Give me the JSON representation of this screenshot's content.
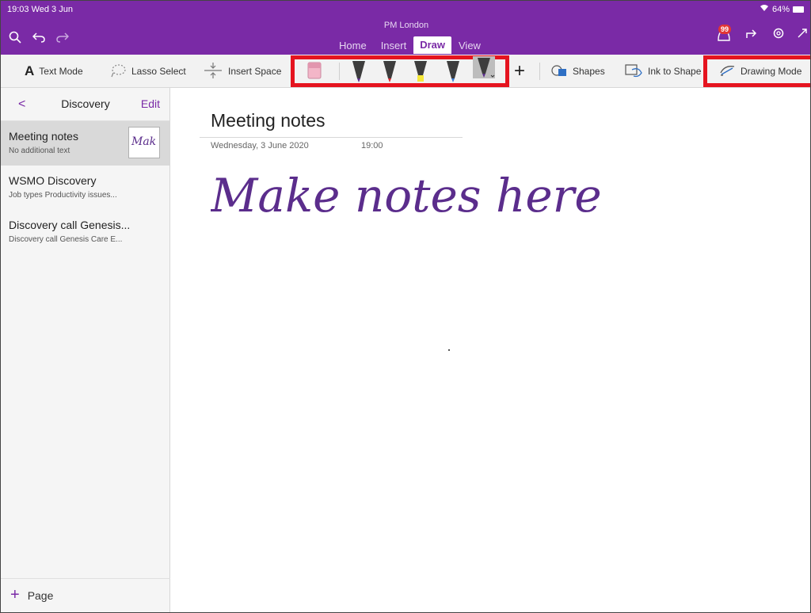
{
  "status": {
    "time": "19:03  Wed 3 Jun",
    "battery": "64%"
  },
  "header": {
    "notebook": "PM London",
    "tabs": [
      {
        "label": "Home"
      },
      {
        "label": "Insert"
      },
      {
        "label": "Draw",
        "active": true
      },
      {
        "label": "View"
      }
    ],
    "notification_count": "99"
  },
  "ribbon": {
    "text_mode": "Text Mode",
    "lasso_select": "Lasso Select",
    "insert_space": "Insert Space",
    "pens": [
      {
        "name": "eraser",
        "color": "#f3b6c8"
      },
      {
        "name": "pen-purple",
        "color": "#5b2d8c"
      },
      {
        "name": "pen-red",
        "color": "#d9252c"
      },
      {
        "name": "highlighter-yellow",
        "color": "#f5e83a"
      },
      {
        "name": "pen-blue",
        "color": "#3a7bd5"
      },
      {
        "name": "pen-dark-selected",
        "color": "#5b2d8c"
      }
    ],
    "add_pen": "+",
    "shapes": "Shapes",
    "ink_to_shape": "Ink to Shape",
    "drawing_mode": "Drawing Mode"
  },
  "sidebar": {
    "back": "<",
    "section": "Discovery",
    "edit": "Edit",
    "pages": [
      {
        "title": "Meeting notes",
        "subtitle": "No additional text",
        "selected": true,
        "thumb_text": "Mak"
      },
      {
        "title": "WSMO Discovery",
        "subtitle": "Job types  Productivity issues..."
      },
      {
        "title": "Discovery call Genesis...",
        "subtitle": "Discovery call Genesis Care E..."
      }
    ],
    "add_page": "Page"
  },
  "note": {
    "title": "Meeting notes",
    "date": "Wednesday, 3 June 2020",
    "time": "19:00",
    "handwriting": "Make notes here",
    "ink_color": "#5b2d8c"
  },
  "colors": {
    "accent": "#7a2aa6",
    "highlight_box": "#e5141f"
  }
}
